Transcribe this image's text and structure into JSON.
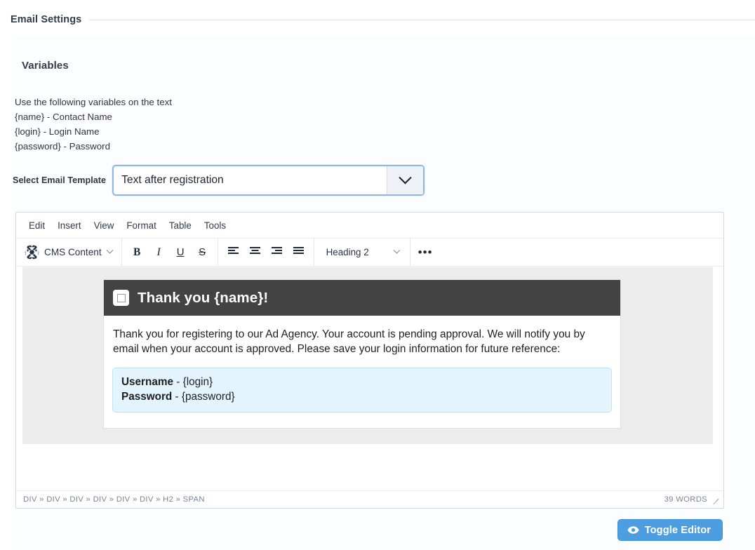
{
  "section": {
    "legend": "Email Settings"
  },
  "variables": {
    "title": "Variables",
    "intro": "Use the following variables on the text",
    "lines": [
      "{name} - Contact Name",
      "{login} - Login Name",
      "{password} - Password"
    ]
  },
  "template_select": {
    "label": "Select Email Template",
    "value": "Text after registration",
    "icon": "chevron-down-icon"
  },
  "editor": {
    "menubar": [
      "Edit",
      "Insert",
      "View",
      "Format",
      "Table",
      "Tools"
    ],
    "toolbar": {
      "cms_content_label": "CMS Content",
      "cms_icon": "joomla-logo-icon",
      "bold": "B",
      "italic": "I",
      "underline": "U",
      "strikethrough": "S",
      "align_left_icon": "align-left-icon",
      "align_center_icon": "align-center-icon",
      "align_right_icon": "align-right-icon",
      "align_justify_icon": "align-justify-icon",
      "block_format": "Heading 2",
      "more_label": "•••"
    },
    "content": {
      "header_icon": "image-placeholder-icon",
      "heading": "Thank you {name}!",
      "paragraph": "Thank you for registering to our Ad Agency. Your account is pending approval. We will notify you by email when your account is approved. Please save your login information for future reference:",
      "credentials": [
        {
          "label": "Username",
          "separator": " - ",
          "value": "{login}"
        },
        {
          "label": "Password",
          "separator": " - ",
          "value": "{password}"
        }
      ]
    },
    "statusbar": {
      "path": "DIV » DIV » DIV » DIV » DIV » DIV » H2 » SPAN",
      "word_count": "39 WORDS",
      "resize_handle": "resize-grip-icon"
    }
  },
  "toggle_editor": {
    "label": "Toggle Editor",
    "icon": "eye-icon"
  },
  "colors": {
    "accent_blue": "#4c9ee0",
    "focus_border": "#8bb8e8",
    "mail_header_bg": "#434343",
    "credentials_bg": "#e3f4fc",
    "editor_band_bg": "#ececec"
  }
}
